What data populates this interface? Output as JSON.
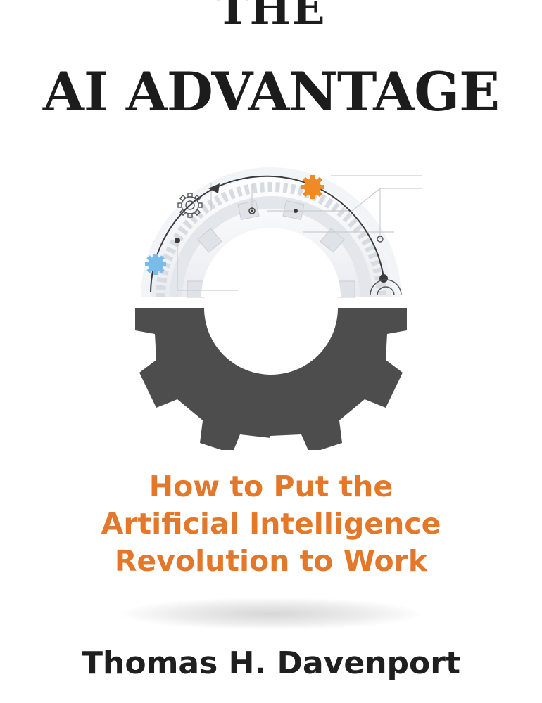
{
  "cover": {
    "title_line_1": "THE",
    "title_line_2": "AI ADVANTAGE",
    "subtitle_lines": [
      "How to Put the",
      "Artificial Intelligence",
      "Revolution to Work"
    ],
    "author": "Thomas H. Davenport"
  },
  "colors": {
    "title": "#1c1c1c",
    "subtitle": "#e4782a",
    "gear_dark": "#4d4d4d",
    "gear_accent_orange": "#f08a24",
    "gear_accent_blue": "#7bbbe8",
    "circuit_line": "#c9ccd0"
  },
  "icons": {
    "dark_gear": "gear-half-dark",
    "light_gear": "gear-half-light-circuit",
    "small_gears": [
      "gear-small-orange",
      "gear-small-blue",
      "gear-small-outline"
    ]
  }
}
